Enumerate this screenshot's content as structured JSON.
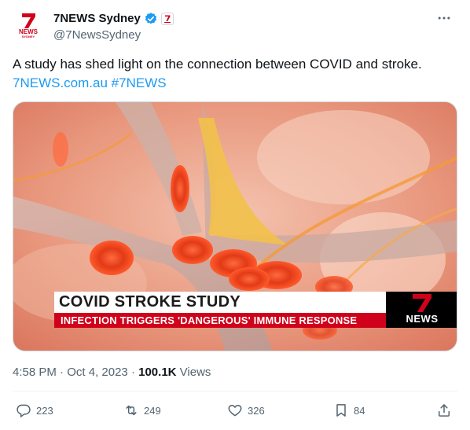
{
  "account": {
    "display_name": "7NEWS Sydney",
    "handle": "@7NewsSydney",
    "avatar_text_top": "NEWS",
    "avatar_text_bottom": "SYDNEY",
    "verified_icon": "verified-badge-icon",
    "affiliate_icon": "seven-network-affiliate-icon"
  },
  "tweet": {
    "text": "A study has shed light on the connection between COVID and stroke.",
    "link_url": "7NEWS.com.au",
    "hashtag": "#7NEWS"
  },
  "media": {
    "headline": "COVID STROKE STUDY",
    "subheadline": "INFECTION TRIGGERS 'DANGEROUS' IMMUNE RESPONSE",
    "logo_text": "NEWS"
  },
  "meta": {
    "time": "4:58 PM",
    "separator": "·",
    "date": "Oct 4, 2023",
    "views_count": "100.1K",
    "views_label": "Views"
  },
  "actions": {
    "reply_count": "223",
    "retweet_count": "249",
    "like_count": "326",
    "bookmark_count": "84"
  },
  "colors": {
    "link": "#1d9bf0",
    "muted": "#536471",
    "brand_red": "#d0021b",
    "verified_blue": "#1d9bf0"
  }
}
